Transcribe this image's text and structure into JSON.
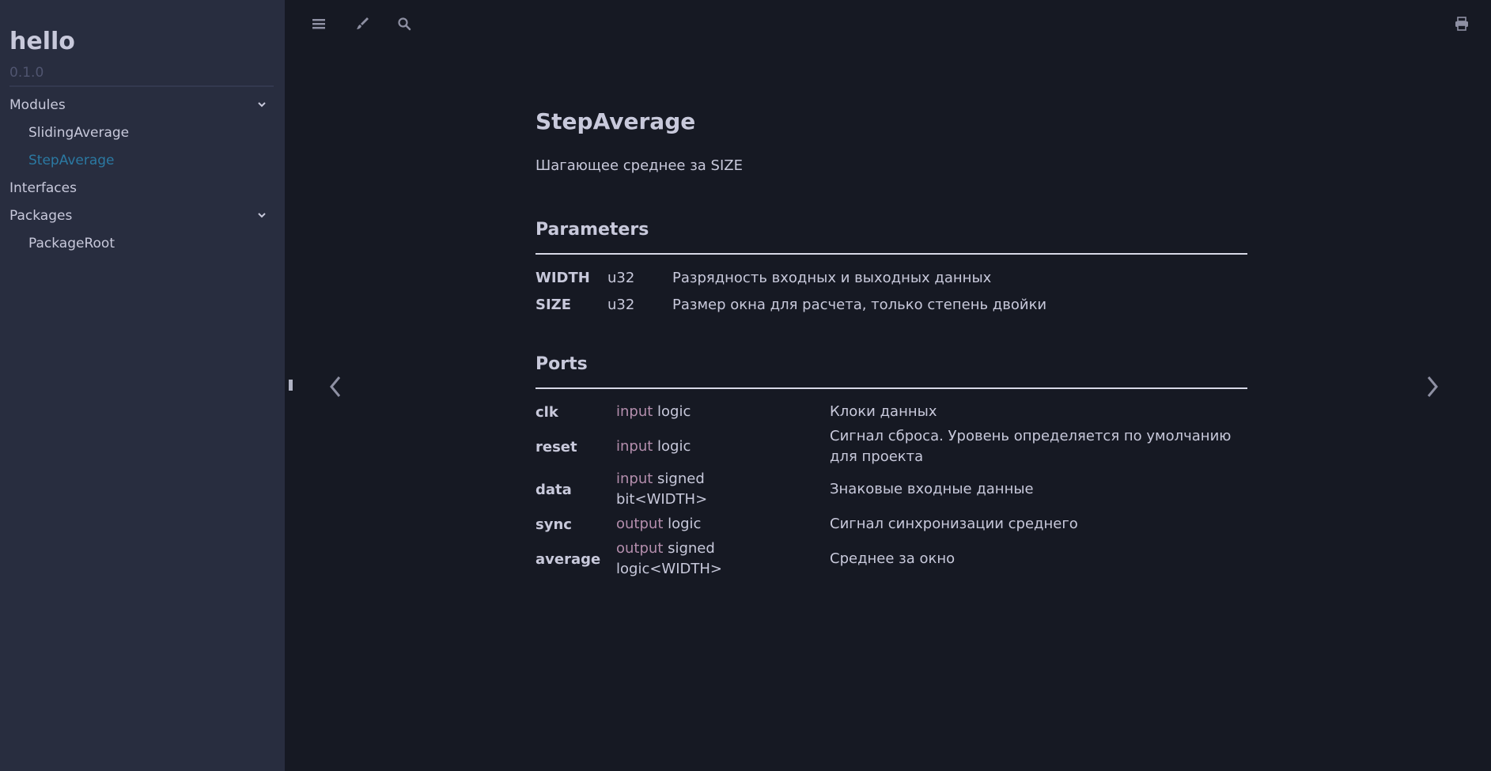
{
  "sidebar": {
    "title": "hello",
    "version": "0.1.0",
    "items": [
      {
        "label": "Modules"
      },
      {
        "label": "SlidingAverage"
      },
      {
        "label": "StepAverage"
      },
      {
        "label": "Interfaces"
      },
      {
        "label": "Packages"
      },
      {
        "label": "PackageRoot"
      }
    ]
  },
  "toolbar": {
    "icons": [
      "menu-icon",
      "paintbrush-icon",
      "search-icon",
      "print-icon"
    ]
  },
  "page": {
    "title": "StepAverage",
    "description": "Шагающее среднее за SIZE",
    "parameters_heading": "Parameters",
    "parameters": [
      {
        "name": "WIDTH",
        "type": "u32",
        "desc": "Разрядность входных и выходных данных"
      },
      {
        "name": "SIZE",
        "type": "u32",
        "desc": "Размер окна для расчета, только степень двойки"
      }
    ],
    "ports_heading": "Ports",
    "ports": [
      {
        "name": "clk",
        "dir": "input",
        "type": " logic",
        "desc": "Клоки данных"
      },
      {
        "name": "reset",
        "dir": "input",
        "type": " logic",
        "desc": "Сигнал сброса. Уровень определяется по умолчанию для проекта"
      },
      {
        "name": "data",
        "dir": "input",
        "type": " signed bit<WIDTH>",
        "desc": "Знаковые входные данные"
      },
      {
        "name": "sync",
        "dir": "output",
        "type": " logic",
        "desc": "Сигнал синхронизации среднего"
      },
      {
        "name": "average",
        "dir": "output",
        "type": " signed logic<WIDTH>",
        "desc": "Среднее за окно"
      }
    ]
  },
  "colors": {
    "sidebar_bg": "#282d3f",
    "content_bg": "#161923",
    "text": "#c8c9db",
    "active_link": "#2b79a2",
    "keyword": "#b48ead"
  }
}
